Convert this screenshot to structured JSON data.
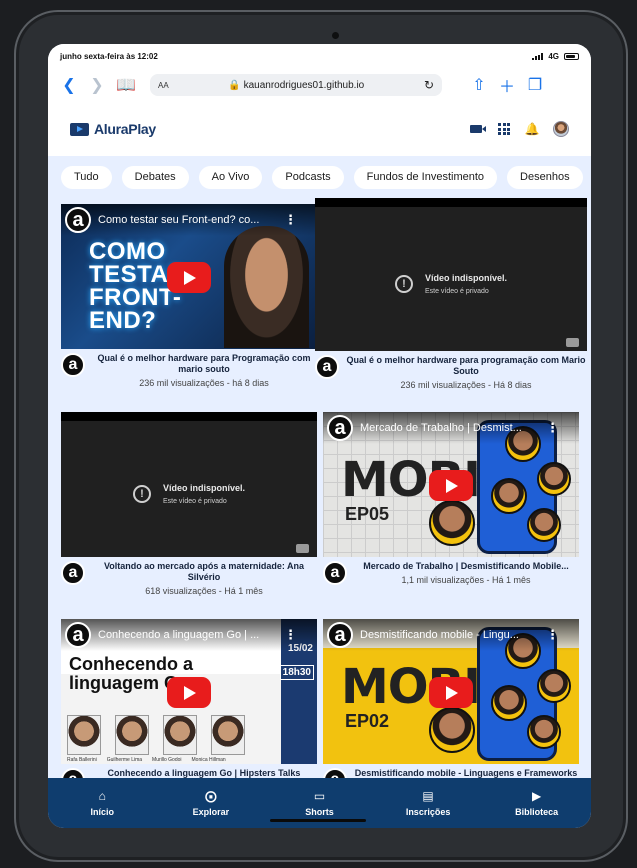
{
  "status": {
    "time": "junho sexta-feira às 12:02",
    "network": "4G"
  },
  "browser": {
    "text_size": "AA",
    "url": "kauanrodrigues01.github.io"
  },
  "app": {
    "name": "AluraPlay"
  },
  "categories": [
    "Tudo",
    "Debates",
    "Ao Vivo",
    "Podcasts",
    "Fundos de Investimento",
    "Desenhos"
  ],
  "videos": [
    {
      "thumb_title": "Como testar seu Front-end? co...",
      "thumb_text": "COMO TESTAR FRONT-END?",
      "title": "Qual é o melhor hardware para Programação com mario souto",
      "stats": "236 mil visualizações - há 8 dias"
    },
    {
      "unavailable": "Vídeo indisponível.",
      "private": "Este vídeo é privado",
      "title": "Qual é o melhor hardware para programação com Mario Souto",
      "stats": "236 mil visualizações - Há 8 dias"
    },
    {
      "unavailable": "Vídeo indisponível.",
      "private": "Este vídeo é privado",
      "title": "Voltando ao mercado após a maternidade: Ana Silvério",
      "stats": "618 visualizações - Há 1 mês"
    },
    {
      "thumb_title": "Mercado de Trabalho | Desmist...",
      "big": "MOBILE",
      "ep": "EP05",
      "title": "Mercado de Trabalho | Desmistificando Mobile...",
      "stats": "1,1 mil visualizações - Há 1 mês"
    },
    {
      "thumb_title": "Conhecendo a linguagem Go | ...",
      "go_title": "Conhecendo a linguagem Go",
      "date": "15/02",
      "time": "18h30",
      "speakers": [
        "Rafa Ballerini",
        "Guilherme Lima",
        "Murillo Godoi",
        "Monica Hillman"
      ],
      "title": "Conhecendo a linguagem Go | Hipsters Talks"
    },
    {
      "thumb_title": "Desmistificando mobile - Lingu...",
      "big": "MOBILE",
      "ep": "EP02",
      "title": "Desmistificando mobile - Linguagens e Frameworks"
    }
  ],
  "nav": [
    {
      "label": "Início",
      "icon": "home-icon"
    },
    {
      "label": "Explorar",
      "icon": "compass-icon"
    },
    {
      "label": "Shorts",
      "icon": "tv-icon"
    },
    {
      "label": "Inscrições",
      "icon": "subscriptions-icon"
    },
    {
      "label": "Biblioteca",
      "icon": "library-icon"
    }
  ]
}
